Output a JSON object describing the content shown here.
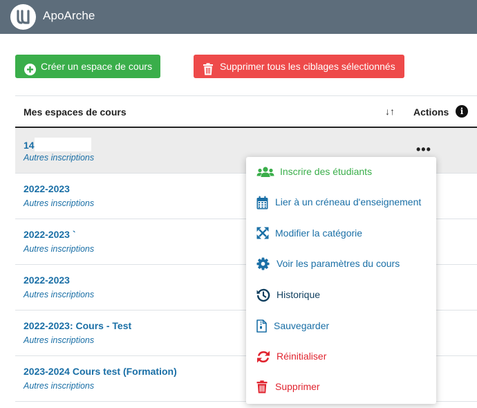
{
  "app": {
    "title": "ApoArche",
    "logo_icon": "logo-u-icon"
  },
  "toolbar": {
    "create_label": "Créer un espace de cours",
    "create_color": "#3aae4a",
    "delete_label": "Supprimer tous les ciblages sélectionnés",
    "delete_color": "#ee4a4a"
  },
  "table": {
    "header_title": "Mes espaces de cours",
    "sort_symbol": "↓↑",
    "header_actions": "Actions",
    "info_symbol": "i",
    "rows": [
      {
        "course": "14",
        "sub": "Autres inscriptions"
      },
      {
        "course": "2022-2023",
        "sub": "Autres inscriptions"
      },
      {
        "course": "2022-2023 `",
        "sub": "Autres inscriptions"
      },
      {
        "course": "2022-2023",
        "sub": "Autres inscriptions"
      },
      {
        "course": "2022-2023: Cours - Test",
        "sub": "Autres inscriptions"
      },
      {
        "course": "2023-2024 Cours test (Formation)",
        "sub": "Autres inscriptions"
      }
    ],
    "actions_symbol": "•••"
  },
  "menu": {
    "items": [
      {
        "label": "Inscrire des étudiants",
        "icon": "users-icon",
        "color": "#3aae4a"
      },
      {
        "label": "Lier à un créneau d'enseignement",
        "icon": "calendar-icon",
        "color": "#1a6fa6"
      },
      {
        "label": "Modifier la catégorie",
        "icon": "expand-arrows-icon",
        "color": "#1a6fa6"
      },
      {
        "label": "Voir les paramètres du cours",
        "icon": "gear-icon",
        "color": "#1a6fa6"
      },
      {
        "label": "Historique",
        "icon": "history-icon",
        "color": "#0f3e5e"
      },
      {
        "label": "Sauvegarder",
        "icon": "file-archive-icon",
        "color": "#1a6fa6"
      },
      {
        "label": "Réinitialiser",
        "icon": "sync-icon",
        "color": "#e0242f"
      },
      {
        "label": "Supprimer",
        "icon": "trash-icon",
        "color": "#e0242f"
      }
    ]
  }
}
